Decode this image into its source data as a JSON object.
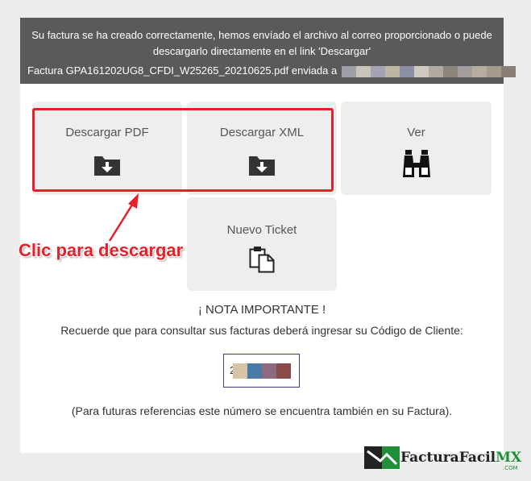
{
  "banner": {
    "line1": "Su factura se ha creado correctamente, hemos envíado el archivo al correo proporcionado o puede",
    "line2": "descargarlo directamente en el link 'Descargar'",
    "line3_prefix": "Factura GPA161202UG8_CFDI_W25265_20210625.pdf enviada a",
    "redacted_colors": [
      "#9e9ea6",
      "#c9c3bb",
      "#a5a2b3",
      "#bdb6a3",
      "#8a8fa3",
      "#cfc9c1",
      "#b0aaa0",
      "#8c857b",
      "#a39e9c",
      "#b6aca1",
      "#a69a8b",
      "#8a7d74"
    ]
  },
  "cards": {
    "pdf": {
      "label": "Descargar PDF",
      "icon": "folder-download-icon"
    },
    "xml": {
      "label": "Descargar XML",
      "icon": "folder-download-icon"
    },
    "ver": {
      "label": "Ver",
      "icon": "binoculars-icon"
    },
    "ticket": {
      "label": "Nuevo Ticket",
      "icon": "clipboard-copy-icon"
    }
  },
  "callout": {
    "text": "Clic para descargar",
    "color": "#e8202a"
  },
  "nota": {
    "title": "¡ NOTA IMPORTANTE !",
    "text": "Recuerde que para consultar sus facturas deberá ingresar su Código de Cliente:",
    "code_prefix": "2",
    "code_colors": [
      "#d9c4a6",
      "#4a7aa8",
      "#8e6a7e",
      "#8a4a48"
    ],
    "footnote": "(Para futuras referencias este número se encuentra también en su Factura)."
  },
  "logo": {
    "name_main": "FacturaFacil",
    "name_accent": "MX",
    "domain": ".COM",
    "accent_color": "#1f8f3a"
  }
}
